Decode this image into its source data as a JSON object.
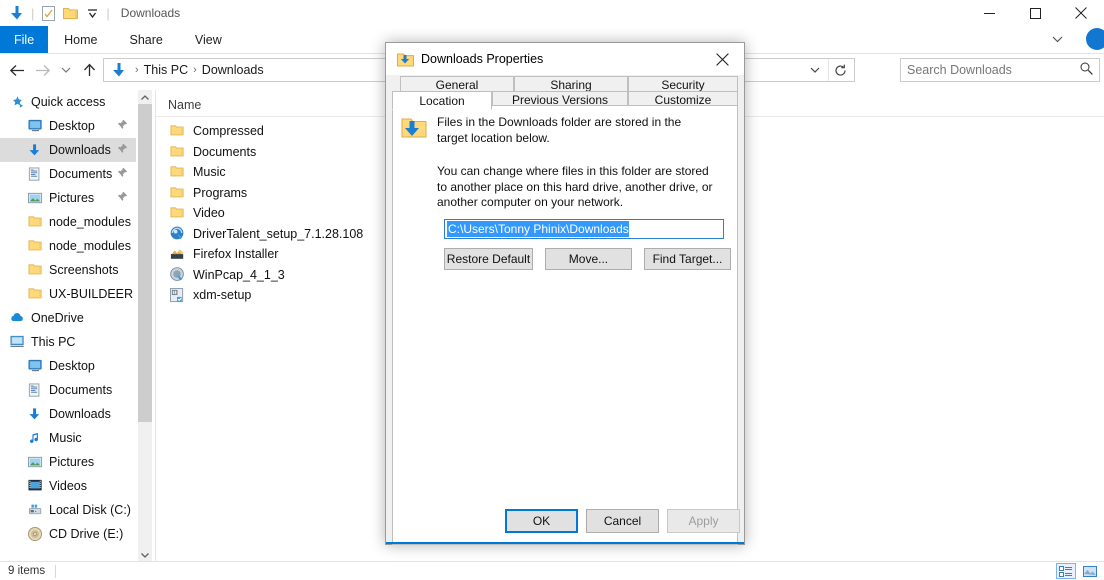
{
  "window": {
    "title": "Downloads",
    "quick_access_icons": [
      "downloads-arrow-icon",
      "properties-icon",
      "new-folder-icon",
      "customize-qat-chevron-icon"
    ],
    "controls": {
      "minimize": "—",
      "maximize": "□",
      "close": "✕"
    }
  },
  "ribbon": {
    "tabs": [
      {
        "label": "File",
        "active": true
      },
      {
        "label": "Home",
        "active": false
      },
      {
        "label": "Share",
        "active": false
      },
      {
        "label": "View",
        "active": false
      }
    ]
  },
  "address": {
    "crumbs": [
      "This PC",
      "Downloads"
    ],
    "separator": "›",
    "back_title": "Back",
    "forward_title": "Forward",
    "recent_title": "Recent locations",
    "up_title": "Up"
  },
  "search": {
    "placeholder": "Search Downloads",
    "icon": "search-icon"
  },
  "navpane": {
    "items": [
      {
        "label": "Quick access",
        "icon": "star-icon",
        "level": 0,
        "pinned": false,
        "selected": false
      },
      {
        "label": "Desktop",
        "icon": "desktop-icon",
        "level": 1,
        "pinned": true,
        "selected": false
      },
      {
        "label": "Downloads",
        "icon": "downloads-icon",
        "level": 1,
        "pinned": true,
        "selected": true
      },
      {
        "label": "Documents",
        "icon": "documents-icon",
        "level": 1,
        "pinned": true,
        "selected": false
      },
      {
        "label": "Pictures",
        "icon": "pictures-icon",
        "level": 1,
        "pinned": true,
        "selected": false
      },
      {
        "label": "node_modules",
        "icon": "folder-icon",
        "level": 1,
        "pinned": false,
        "selected": false
      },
      {
        "label": "node_modules",
        "icon": "folder-icon",
        "level": 1,
        "pinned": false,
        "selected": false
      },
      {
        "label": "Screenshots",
        "icon": "folder-icon",
        "level": 1,
        "pinned": false,
        "selected": false
      },
      {
        "label": "UX-BUILDEER",
        "icon": "folder-icon",
        "level": 1,
        "pinned": false,
        "selected": false
      },
      {
        "label": "OneDrive",
        "icon": "cloud-icon",
        "level": 0,
        "pinned": false,
        "selected": false
      },
      {
        "label": "This PC",
        "icon": "computer-icon",
        "level": 0,
        "pinned": false,
        "selected": false
      },
      {
        "label": "Desktop",
        "icon": "desktop-icon",
        "level": 1,
        "pinned": false,
        "selected": false
      },
      {
        "label": "Documents",
        "icon": "documents-icon",
        "level": 1,
        "pinned": false,
        "selected": false
      },
      {
        "label": "Downloads",
        "icon": "downloads-icon",
        "level": 1,
        "pinned": false,
        "selected": false
      },
      {
        "label": "Music",
        "icon": "music-icon",
        "level": 1,
        "pinned": false,
        "selected": false
      },
      {
        "label": "Pictures",
        "icon": "pictures-icon",
        "level": 1,
        "pinned": false,
        "selected": false
      },
      {
        "label": "Videos",
        "icon": "videos-icon",
        "level": 1,
        "pinned": false,
        "selected": false
      },
      {
        "label": "Local Disk (C:)",
        "icon": "drive-icon",
        "level": 1,
        "pinned": false,
        "selected": false
      },
      {
        "label": "CD Drive (E:)",
        "icon": "cd-drive-icon",
        "level": 1,
        "pinned": false,
        "selected": false
      }
    ]
  },
  "filelist": {
    "column_header": "Name",
    "sort_indicator": "▴",
    "rows": [
      {
        "name": "Compressed",
        "icon": "folder-icon"
      },
      {
        "name": "Documents",
        "icon": "folder-icon"
      },
      {
        "name": "Music",
        "icon": "folder-icon"
      },
      {
        "name": "Programs",
        "icon": "folder-icon"
      },
      {
        "name": "Video",
        "icon": "folder-icon"
      },
      {
        "name": "DriverTalent_setup_7.1.28.108",
        "icon": "drivertalent-app-icon"
      },
      {
        "name": "Firefox Installer",
        "icon": "firefox-installer-icon"
      },
      {
        "name": "WinPcap_4_1_3",
        "icon": "winpcap-app-icon"
      },
      {
        "name": "xdm-setup",
        "icon": "installer-icon"
      }
    ]
  },
  "statusbar": {
    "item_count": "9 items",
    "view_details_icon": "details-view-icon",
    "view_large_icons_icon": "large-icons-view-icon"
  },
  "dialog": {
    "title": "Downloads Properties",
    "icon": "downloads-folder-icon",
    "close_label": "✕",
    "tabs_row1": [
      {
        "label": "General",
        "active": false
      },
      {
        "label": "Sharing",
        "active": false
      },
      {
        "label": "Security",
        "active": false
      }
    ],
    "tabs_row2": [
      {
        "label": "Location",
        "active": true
      },
      {
        "label": "Previous Versions",
        "active": false
      },
      {
        "label": "Customize",
        "active": false
      }
    ],
    "location": {
      "heading": "Files in the Downloads folder are stored in the target location below.",
      "description": "You can change where files in this folder are stored to another place on this hard drive, another drive, or another computer on your network.",
      "path_value": "C:\\Users\\Tonny Phinix\\Downloads",
      "path_selected": true,
      "buttons": [
        {
          "label": "Restore Default",
          "disabled": false
        },
        {
          "label": "Move...",
          "disabled": false
        },
        {
          "label": "Find Target...",
          "disabled": false
        }
      ]
    },
    "footer": [
      {
        "label": "OK",
        "disabled": false,
        "default": true
      },
      {
        "label": "Cancel",
        "disabled": false,
        "default": false
      },
      {
        "label": "Apply",
        "disabled": true,
        "default": false
      }
    ]
  },
  "colors": {
    "accent": "#0078d7",
    "selection": "#3399ff",
    "nav_selected": "#dcdcdc",
    "folder_yellow": "#ffd87a",
    "dialog_bg": "#f0f0f0"
  }
}
